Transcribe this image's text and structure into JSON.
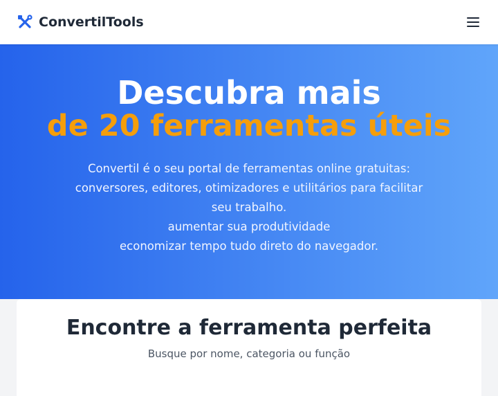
{
  "navbar": {
    "brand_name": "ConvertilTools",
    "brand_icon": "tools-icon",
    "menu_icon": "hamburger-menu-icon"
  },
  "hero": {
    "title_line1": "Descubra mais",
    "title_line2": "de 20 ferramentas úteis",
    "description_lines": [
      "Convertil é o seu portal de ferramentas online gratuitas:",
      "conversores, editores, otimizadores e utilitários para facilitar",
      "seu trabalho.",
      "aumentar sua produtividade",
      "economizar tempo tudo direto do navegador."
    ]
  },
  "search_section": {
    "title": "Encontre a ferramenta perfeita",
    "subtitle": "Busque por nome, categoria ou função"
  },
  "colors": {
    "accent_orange": "#f59e0b",
    "gradient_start": "#2563eb",
    "gradient_end": "#60a5fa",
    "brand_icon_blue": "#2563eb"
  }
}
